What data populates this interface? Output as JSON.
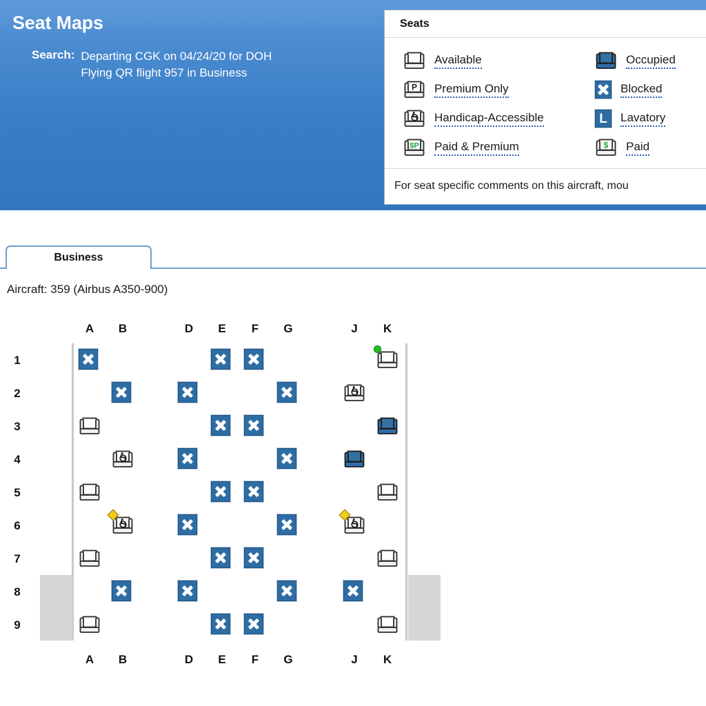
{
  "header": {
    "title": "Seat Maps",
    "search_label": "Search:",
    "search_lines": [
      "Departing CGK on 04/24/20 for DOH",
      "Flying QR flight 957 in Business"
    ]
  },
  "legend": {
    "title": "Seats",
    "left_items": [
      {
        "icon": "seat-available-icon",
        "label": "Available"
      },
      {
        "icon": "seat-premium-only-icon",
        "label": "Premium Only"
      },
      {
        "icon": "seat-handicap-accessible-icon",
        "label": "Handicap-Accessible"
      },
      {
        "icon": "seat-paid-and-premium-icon",
        "label": "Paid & Premium"
      }
    ],
    "right_items": [
      {
        "icon": "seat-occupied-icon",
        "label": "Occupied"
      },
      {
        "icon": "seat-blocked-icon",
        "label": "Blocked"
      },
      {
        "icon": "lavatory-icon",
        "label": "Lavatory"
      },
      {
        "icon": "seat-paid-icon",
        "label": "Paid"
      }
    ],
    "footer_note": "For seat specific comments on this aircraft, mou"
  },
  "tabs": [
    {
      "label": "Business",
      "selected": true
    }
  ],
  "aircraft": "Aircraft: 359 (Airbus A350-900)",
  "seatmap": {
    "columns": [
      "A",
      "B",
      "D",
      "E",
      "F",
      "G",
      "J",
      "K"
    ],
    "rows": [
      "1",
      "2",
      "3",
      "4",
      "5",
      "6",
      "7",
      "8",
      "9"
    ],
    "legend_colors": {
      "blocked_tile": "#2e6da4",
      "occupied_fill": "#2f6ca8",
      "wing_block": "#d6d6d6",
      "cabin_wall": "#c9c9c9",
      "marker_green": "#22c01e",
      "marker_yellow": "#f3cc1a"
    },
    "seats": [
      {
        "row": "1",
        "col": "A",
        "state": "blocked"
      },
      {
        "row": "1",
        "col": "E",
        "state": "blocked"
      },
      {
        "row": "1",
        "col": "F",
        "state": "blocked"
      },
      {
        "row": "1",
        "col": "K",
        "state": "available",
        "marker": "green"
      },
      {
        "row": "2",
        "col": "B",
        "state": "blocked"
      },
      {
        "row": "2",
        "col": "D",
        "state": "blocked"
      },
      {
        "row": "2",
        "col": "G",
        "state": "blocked"
      },
      {
        "row": "2",
        "col": "J",
        "state": "handicap"
      },
      {
        "row": "3",
        "col": "A",
        "state": "available"
      },
      {
        "row": "3",
        "col": "E",
        "state": "blocked"
      },
      {
        "row": "3",
        "col": "F",
        "state": "blocked"
      },
      {
        "row": "3",
        "col": "K",
        "state": "occupied"
      },
      {
        "row": "4",
        "col": "B",
        "state": "handicap"
      },
      {
        "row": "4",
        "col": "D",
        "state": "blocked"
      },
      {
        "row": "4",
        "col": "G",
        "state": "blocked"
      },
      {
        "row": "4",
        "col": "J",
        "state": "occupied"
      },
      {
        "row": "5",
        "col": "A",
        "state": "available"
      },
      {
        "row": "5",
        "col": "E",
        "state": "blocked"
      },
      {
        "row": "5",
        "col": "F",
        "state": "blocked"
      },
      {
        "row": "5",
        "col": "K",
        "state": "available"
      },
      {
        "row": "6",
        "col": "B",
        "state": "handicap",
        "marker": "yellow"
      },
      {
        "row": "6",
        "col": "D",
        "state": "blocked"
      },
      {
        "row": "6",
        "col": "G",
        "state": "blocked"
      },
      {
        "row": "6",
        "col": "J",
        "state": "handicap",
        "marker": "yellow"
      },
      {
        "row": "7",
        "col": "A",
        "state": "available"
      },
      {
        "row": "7",
        "col": "E",
        "state": "blocked"
      },
      {
        "row": "7",
        "col": "F",
        "state": "blocked"
      },
      {
        "row": "7",
        "col": "K",
        "state": "available"
      },
      {
        "row": "8",
        "col": "B",
        "state": "blocked"
      },
      {
        "row": "8",
        "col": "D",
        "state": "blocked"
      },
      {
        "row": "8",
        "col": "G",
        "state": "blocked"
      },
      {
        "row": "8",
        "col": "J",
        "state": "blocked"
      },
      {
        "row": "9",
        "col": "A",
        "state": "available"
      },
      {
        "row": "9",
        "col": "E",
        "state": "blocked"
      },
      {
        "row": "9",
        "col": "F",
        "state": "blocked"
      },
      {
        "row": "9",
        "col": "K",
        "state": "available"
      }
    ]
  }
}
